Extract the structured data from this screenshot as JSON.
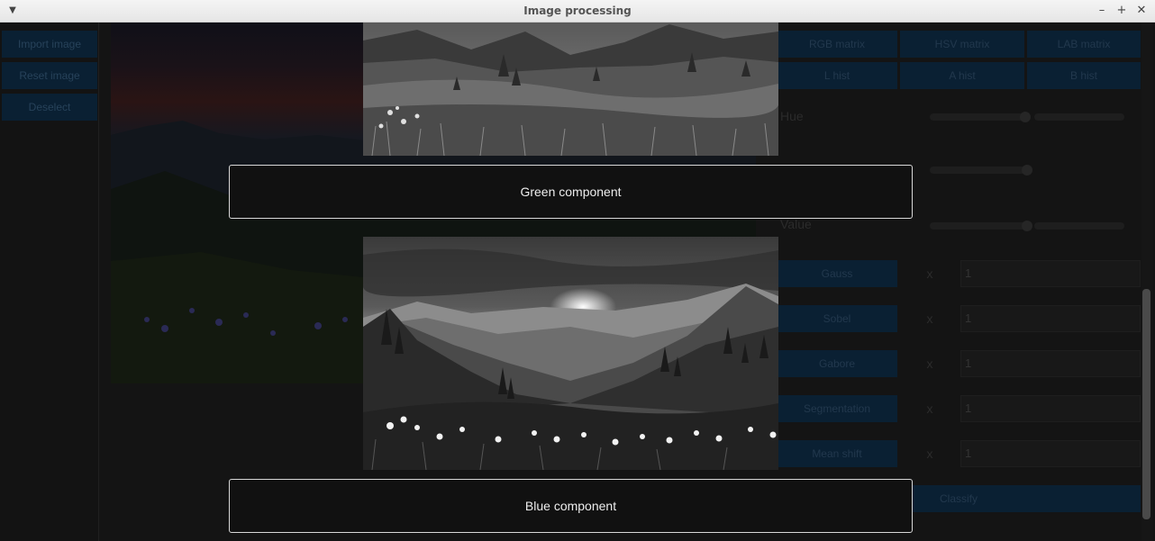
{
  "window": {
    "title": "Image processing"
  },
  "left_panel": {
    "buttons": [
      "Import image",
      "Reset image",
      "Deselect"
    ]
  },
  "right_panel": {
    "matrix_buttons": [
      "RGB matrix",
      "HSV matrix",
      "LAB matrix"
    ],
    "hist_buttons": [
      "L hist",
      "A hist",
      "B hist"
    ],
    "hue_label": "Hue",
    "value_label": "Value",
    "filters": [
      {
        "label": "Gauss",
        "x": "x",
        "value": "1"
      },
      {
        "label": "Sobel",
        "x": "x",
        "value": "1"
      },
      {
        "label": "Gabore",
        "x": "x",
        "value": "1"
      },
      {
        "label": "Segmentation",
        "x": "x",
        "value": "1"
      },
      {
        "label": "Mean shift",
        "x": "x",
        "value": "1"
      }
    ],
    "classify_label": "Classify"
  },
  "dialog": {
    "green_caption": "Green component",
    "blue_caption": "Blue component"
  },
  "colors": {
    "button_bg": "#0a2033",
    "accent_scroll": "#4a4a4a"
  },
  "icons": {
    "menu": "chevron-down-icon",
    "minimize": "minimize-icon",
    "maximize": "maximize-icon",
    "close": "close-icon"
  }
}
